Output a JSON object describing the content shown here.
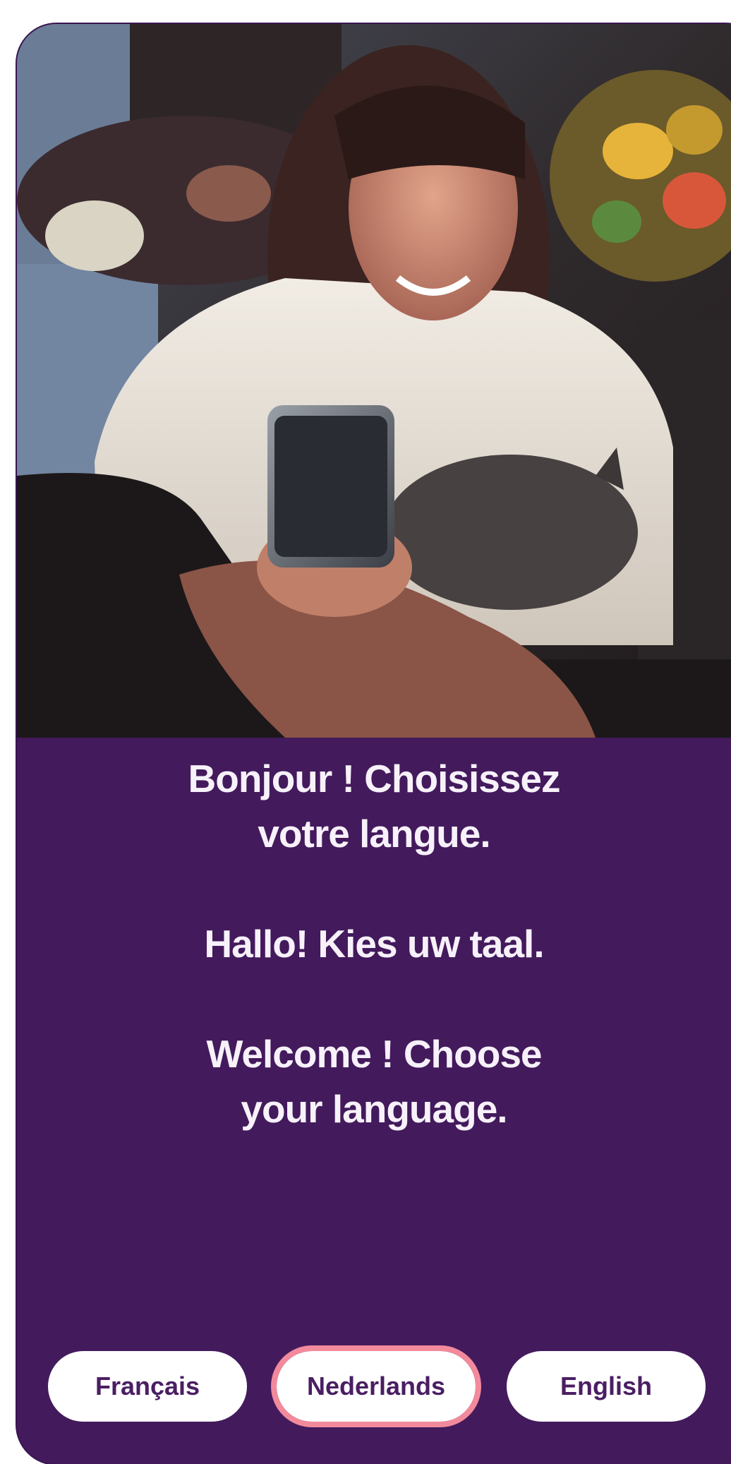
{
  "welcome": {
    "french": "Bonjour ! Choisissez votre langue.",
    "dutch": "Hallo! Kies uw taal.",
    "english": "Welcome ! Choose your language."
  },
  "languages": [
    {
      "label": "Français",
      "selected": false
    },
    {
      "label": "Nederlands",
      "selected": true
    },
    {
      "label": "English",
      "selected": false
    }
  ],
  "colors": {
    "background": "#431a5c",
    "button_text": "#4a1e63",
    "button_bg": "#ffffff",
    "focus_ring": "#f28a9c"
  }
}
